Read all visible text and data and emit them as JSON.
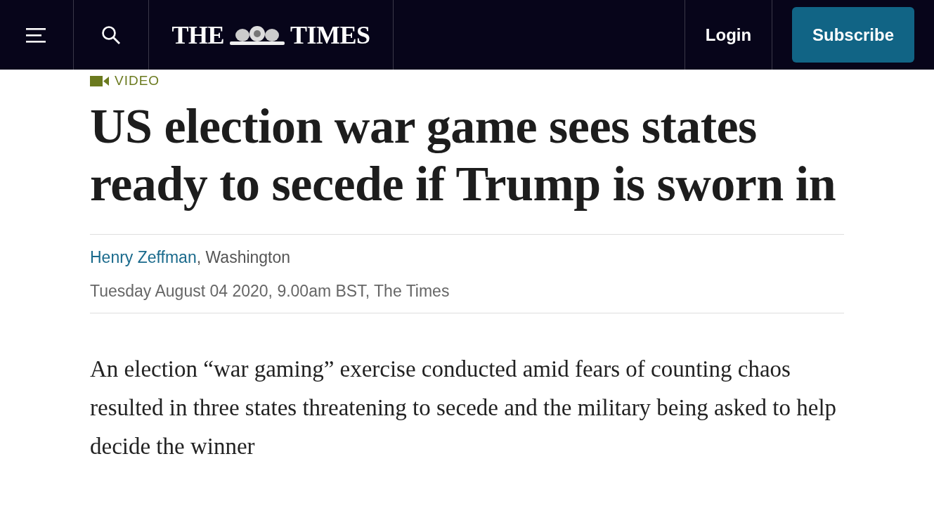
{
  "header": {
    "logo_left": "THE",
    "logo_right": "TIMES",
    "login": "Login",
    "subscribe": "Subscribe"
  },
  "article": {
    "label": "VIDEO",
    "headline": "US election war game sees states ready to secede if Trump is sworn in",
    "author": "Henry Zeffman",
    "location": ", Washington",
    "dateline": "Tuesday August 04 2020, 9.00am BST, The Times",
    "body": "An election “war gaming” exercise conducted amid fears of counting chaos resulted in three states threatening to secede and the military being asked to help decide the winner"
  }
}
